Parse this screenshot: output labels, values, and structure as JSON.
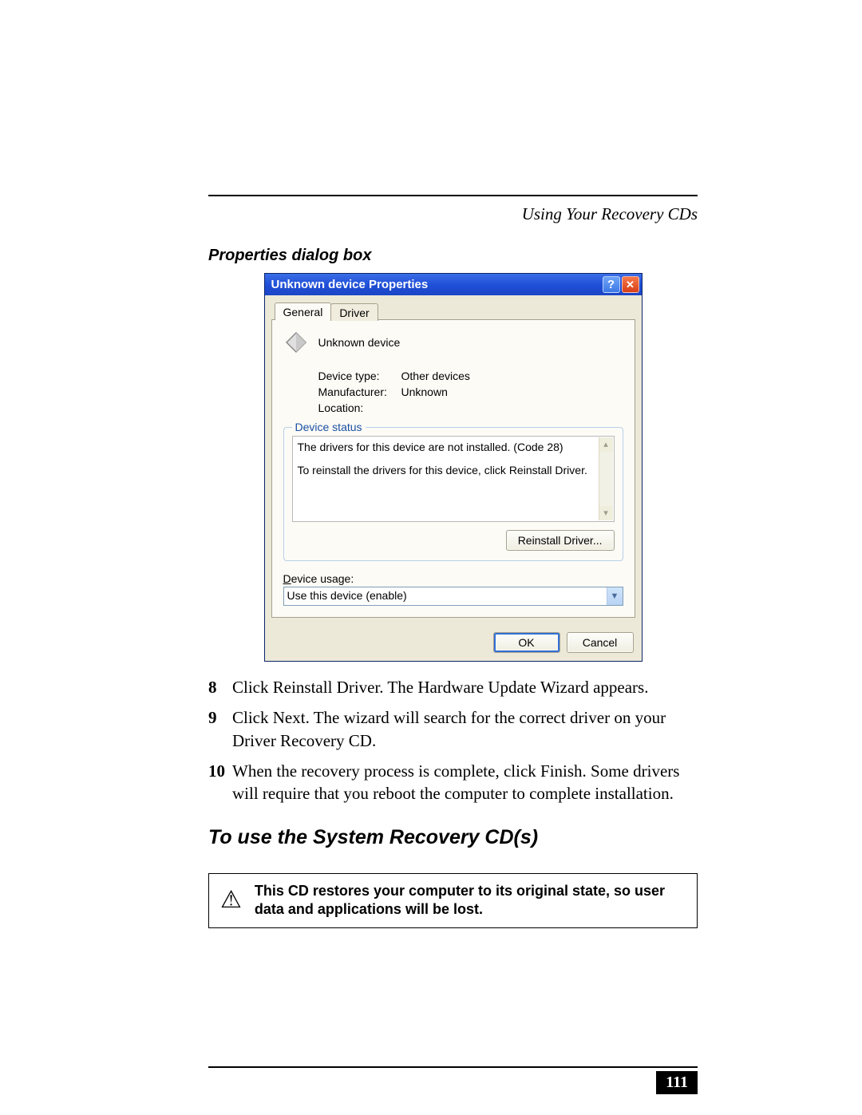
{
  "running_head": "Using Your Recovery CDs",
  "caption": "Properties dialog box",
  "dialog": {
    "title": "Unknown device Properties",
    "tabs": {
      "general": "General",
      "driver": "Driver"
    },
    "device_name": "Unknown device",
    "rows": {
      "type_label": "Device type:",
      "type_value": "Other devices",
      "mfg_label": "Manufacturer:",
      "mfg_value": "Unknown",
      "loc_label": "Location:",
      "loc_value": ""
    },
    "status_legend": "Device status",
    "status_line1": "The drivers for this device are not installed. (Code 28)",
    "status_line2": "To reinstall the drivers for this device, click Reinstall Driver.",
    "reinstall_btn": "Reinstall Driver...",
    "usage_label_pre": "D",
    "usage_label_post": "evice usage:",
    "usage_value": "Use this device (enable)",
    "ok": "OK",
    "cancel": "Cancel"
  },
  "steps": {
    "n8": "8",
    "t8": "Click Reinstall Driver. The Hardware Update Wizard appears.",
    "n9": "9",
    "t9": "Click Next. The wizard will search for the correct driver on your Driver Recovery CD.",
    "n10": "10",
    "t10": "When the recovery process is complete, click Finish. Some drivers will require that you reboot the computer to complete installation."
  },
  "section_heading": "To use the System Recovery CD(s)",
  "warning_text": "This CD restores your computer to its original state, so user data and applications will be lost.",
  "page_number": "111"
}
